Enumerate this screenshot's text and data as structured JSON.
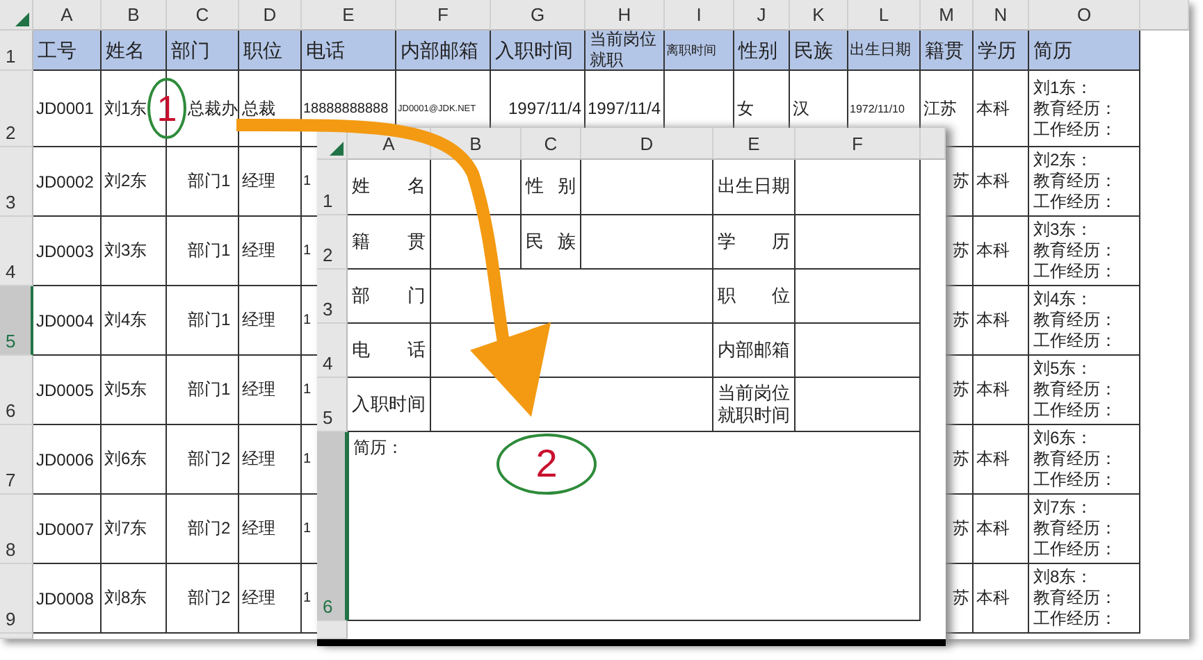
{
  "sheet": {
    "columns": [
      "A",
      "B",
      "C",
      "D",
      "E",
      "F",
      "G",
      "H",
      "I",
      "J",
      "K",
      "L",
      "M",
      "N",
      "O"
    ],
    "header_row": {
      "number": "1",
      "cells": [
        "工号",
        "姓名",
        "部门",
        "职位",
        "电话",
        "内部邮箱",
        "入职时间",
        "当前岗位就职",
        "离职时间",
        "性别",
        "民族",
        "出生日期",
        "籍贯",
        "学历",
        "简历"
      ]
    },
    "rows": [
      {
        "number": "2",
        "selected": false,
        "cells": [
          "JD0001",
          "刘1东",
          "总裁办",
          "总裁",
          "18888888888",
          "JD0001@JDK.NET",
          "1997/11/4",
          "1997/11/4",
          null,
          "女",
          "汉",
          "1972/11/10",
          "江苏",
          "本科",
          [
            "刘1东：",
            "教育经历：",
            "工作经历："
          ]
        ]
      },
      {
        "number": "3",
        "selected": false,
        "cells": [
          "JD0002",
          "刘2东",
          "部门1",
          "经理",
          "1",
          null,
          null,
          null,
          null,
          null,
          null,
          null,
          "苏",
          "本科",
          [
            "刘2东：",
            "教育经历：",
            "工作经历："
          ]
        ]
      },
      {
        "number": "4",
        "selected": false,
        "cells": [
          "JD0003",
          "刘3东",
          "部门1",
          "经理",
          "1",
          null,
          null,
          null,
          null,
          null,
          null,
          null,
          "苏",
          "本科",
          [
            "刘3东：",
            "教育经历：",
            "工作经历："
          ]
        ]
      },
      {
        "number": "5",
        "selected": true,
        "cells": [
          "JD0004",
          "刘4东",
          "部门1",
          "经理",
          "1",
          null,
          null,
          null,
          null,
          null,
          null,
          null,
          "苏",
          "本科",
          [
            "刘4东：",
            "教育经历：",
            "工作经历："
          ]
        ]
      },
      {
        "number": "6",
        "selected": false,
        "cells": [
          "JD0005",
          "刘5东",
          "部门1",
          "经理",
          "1",
          null,
          null,
          null,
          null,
          null,
          null,
          null,
          "苏",
          "本科",
          [
            "刘5东：",
            "教育经历：",
            "工作经历："
          ]
        ]
      },
      {
        "number": "7",
        "selected": false,
        "cells": [
          "JD0006",
          "刘6东",
          "部门2",
          "经理",
          "1",
          null,
          null,
          null,
          null,
          null,
          null,
          null,
          "苏",
          "本科",
          [
            "刘6东：",
            "教育经历：",
            "工作经历："
          ]
        ]
      },
      {
        "number": "8",
        "selected": false,
        "cells": [
          "JD0007",
          "刘7东",
          "部门2",
          "经理",
          "1",
          null,
          null,
          null,
          null,
          null,
          null,
          null,
          "苏",
          "本科",
          [
            "刘7东：",
            "教育经历：",
            "工作经历："
          ]
        ]
      },
      {
        "number": "9",
        "selected": false,
        "cells": [
          "JD0008",
          "刘8东",
          "部门2",
          "经理",
          "1",
          null,
          null,
          null,
          null,
          null,
          null,
          null,
          "苏",
          "本科",
          [
            "刘8东：",
            "教育经历：",
            "工作经历："
          ]
        ]
      }
    ]
  },
  "form_sheet": {
    "columns": [
      "A",
      "B",
      "C",
      "D",
      "E",
      "F"
    ],
    "rows": [
      {
        "number": "1",
        "selected": false,
        "cells": [
          {
            "kind": "label",
            "text": "姓 名"
          },
          {
            "kind": "value"
          },
          {
            "kind": "label",
            "text": "性 别"
          },
          {
            "kind": "value"
          },
          {
            "kind": "label",
            "text": "出生日期"
          },
          {
            "kind": "value"
          }
        ]
      },
      {
        "number": "2",
        "selected": false,
        "cells": [
          {
            "kind": "label",
            "text": "籍 贯"
          },
          {
            "kind": "value"
          },
          {
            "kind": "label",
            "text": "民 族"
          },
          {
            "kind": "value"
          },
          {
            "kind": "label",
            "text": "学 历"
          },
          {
            "kind": "value"
          }
        ]
      },
      {
        "number": "3",
        "selected": false,
        "cells": [
          {
            "kind": "label",
            "text": "部 门"
          },
          {
            "kind": "wide"
          },
          {
            "kind": "label",
            "text": "职 位"
          },
          {
            "kind": "value"
          }
        ]
      },
      {
        "number": "4",
        "selected": false,
        "cells": [
          {
            "kind": "label",
            "text": "电 话"
          },
          {
            "kind": "wide"
          },
          {
            "kind": "label",
            "text": "内部邮箱"
          },
          {
            "kind": "value"
          }
        ]
      },
      {
        "number": "5",
        "selected": false,
        "cells": [
          {
            "kind": "label",
            "text": "入职时间"
          },
          {
            "kind": "wide"
          },
          {
            "kind": "label",
            "text": "当前岗位就职时间"
          },
          {
            "kind": "value"
          }
        ]
      },
      {
        "number": "6",
        "selected": true,
        "cells": [
          {
            "kind": "note",
            "text": "简历："
          }
        ]
      }
    ]
  },
  "annotations": [
    {
      "label": "1"
    },
    {
      "label": "2"
    }
  ]
}
